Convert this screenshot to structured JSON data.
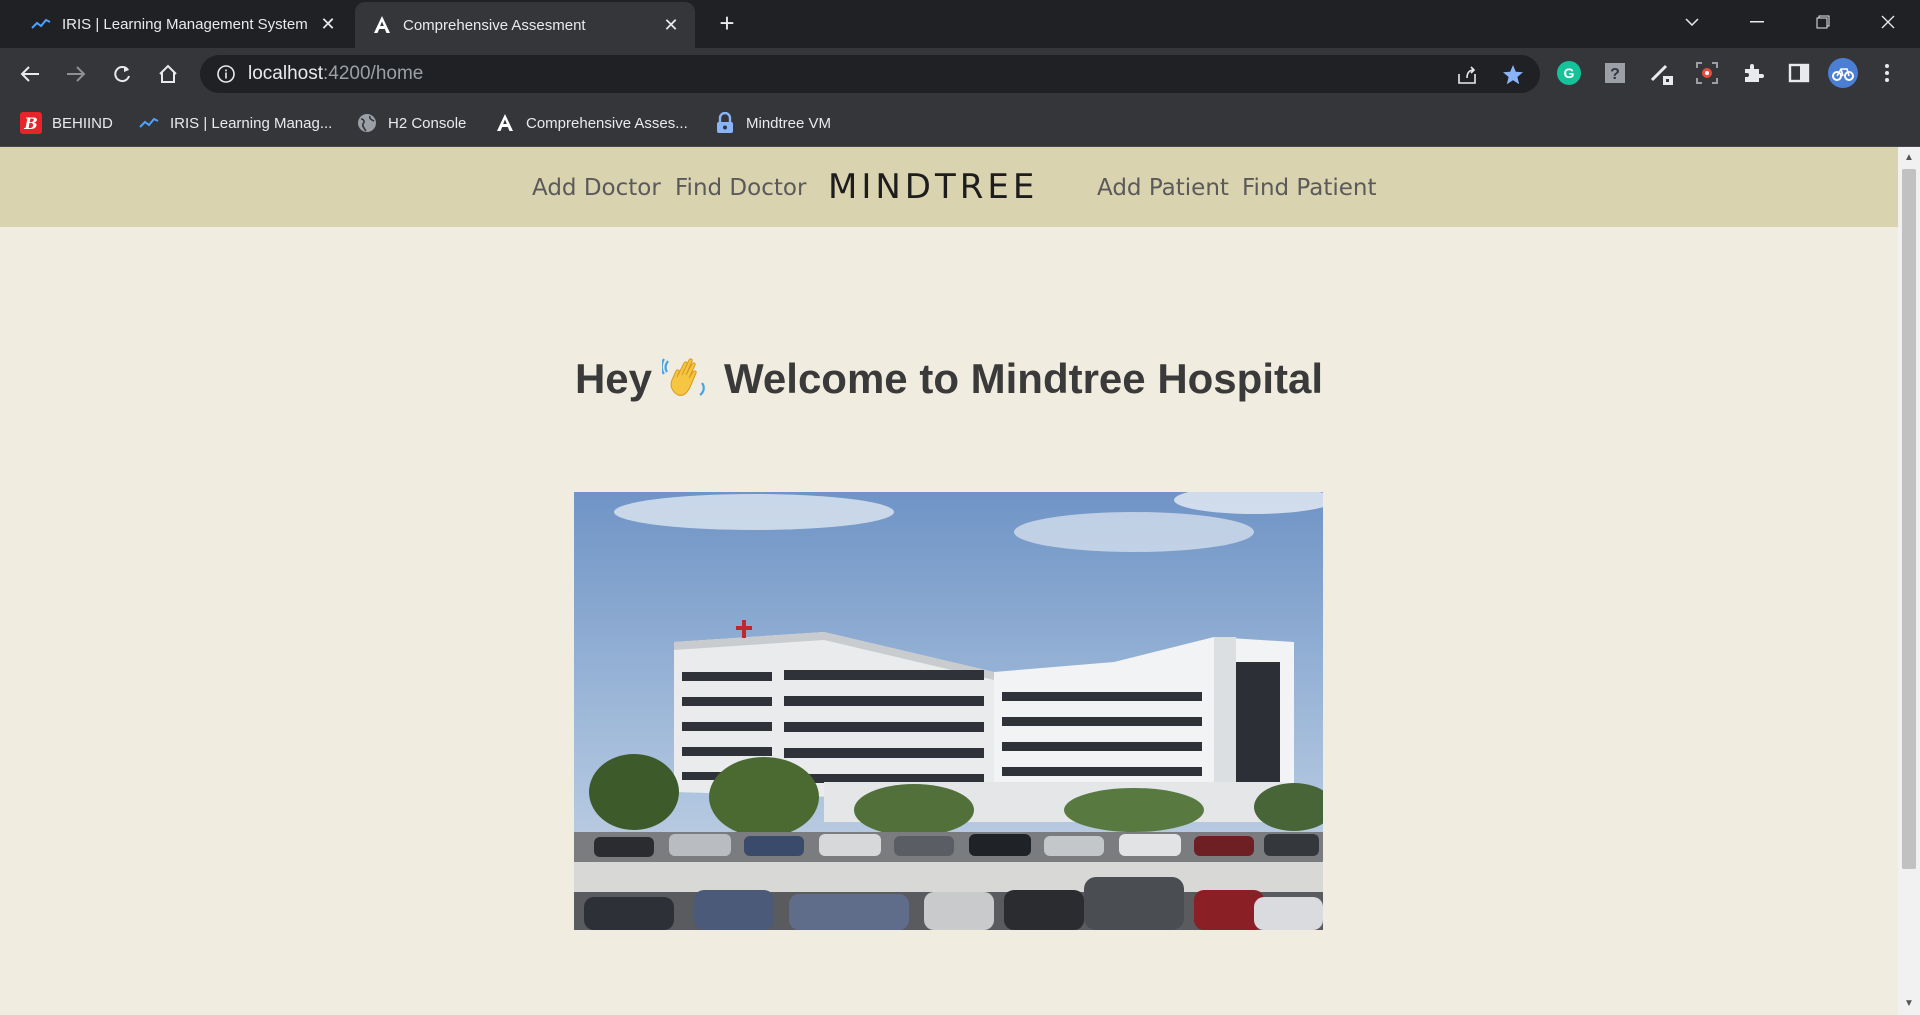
{
  "browser": {
    "tabs": [
      {
        "title": "IRIS | Learning Management System",
        "icon": "iris-icon",
        "active": false
      },
      {
        "title": "Comprehensive Assesment",
        "icon": "angular-icon",
        "active": true
      }
    ],
    "url_host": "localhost",
    "url_path": ":4200/home",
    "bookmarks": [
      {
        "label": "BEHIIND",
        "icon": "behiind-icon"
      },
      {
        "label": "IRIS | Learning Manag...",
        "icon": "iris-icon"
      },
      {
        "label": "H2 Console",
        "icon": "globe-icon"
      },
      {
        "label": "Comprehensive Asses...",
        "icon": "angular-icon"
      },
      {
        "label": "Mindtree VM",
        "icon": "lock-icon"
      }
    ],
    "accent": "#8ab4f8"
  },
  "nav": {
    "add_doctor": "Add Doctor",
    "find_doctor": "Find Doctor",
    "brand": "MINDTREE",
    "add_patient": "Add Patient",
    "find_patient": "Find Patient"
  },
  "main": {
    "hey": "Hey",
    "wave_emoji": "👋",
    "welcome": "Welcome to Mindtree Hospital",
    "image_subject": "hospital-building-photo"
  }
}
